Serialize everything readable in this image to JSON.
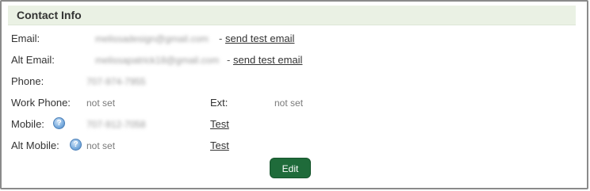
{
  "panel": {
    "title": "Contact Info"
  },
  "email": {
    "label": "Email:",
    "value": "melissadesign@gmail.com",
    "separator": "-",
    "action": "send test email"
  },
  "alt_email": {
    "label": "Alt Email:",
    "value": "melissapatrick18@gmail.com",
    "separator": "-",
    "action": "send test email"
  },
  "phone": {
    "label": "Phone:",
    "value": "707-974-7955"
  },
  "work_phone": {
    "label": "Work Phone:",
    "value": "not set"
  },
  "ext": {
    "label": "Ext:",
    "value": "not set"
  },
  "mobile": {
    "label": "Mobile:",
    "value": "707-912-7058",
    "help_icon": "help-icon",
    "action": "Test"
  },
  "alt_mobile": {
    "label": "Alt Mobile:",
    "value": "not set",
    "help_icon": "help-icon",
    "action": "Test"
  },
  "actions": {
    "edit_label": "Edit"
  },
  "colors": {
    "header_bg": "#eaf1e4",
    "edit_button_bg": "#1f6b3a",
    "help_icon": "#4a84c2"
  }
}
